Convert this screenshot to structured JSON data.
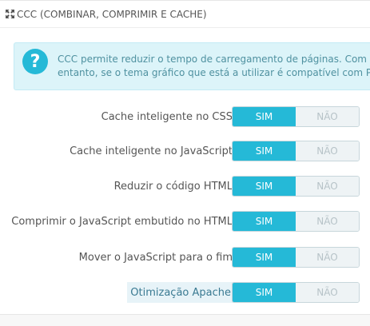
{
  "panel": {
    "title": "CCC (COMBINAR, COMPRIMIR E CACHE)",
    "title_icon": "expand-arrows-icon"
  },
  "alert": {
    "icon": "question-circle-icon",
    "line1": "CCC permite reduzir o tempo de carregamento de páginas. Com estas",
    "line2": "entanto, se o tema gráfico que está a utilizar é compatível com PrestaS",
    "colors": {
      "background": "#dcf4f9",
      "icon": "#25b9d7",
      "text": "#4f91a0"
    }
  },
  "options": [
    {
      "label": "Cache inteligente no CSS",
      "yes": "SIM",
      "no": "NÃO",
      "value": "yes"
    },
    {
      "label": "Cache inteligente no JavaScript",
      "yes": "SIM",
      "no": "NÃO",
      "value": "yes"
    },
    {
      "label": "Reduzir o código HTML",
      "yes": "SIM",
      "no": "NÃO",
      "value": "yes"
    },
    {
      "label": "Comprimir o JavaScript embutido no HTML",
      "yes": "SIM",
      "no": "NÃO",
      "value": "yes"
    },
    {
      "label": "Mover o JavaScript para o fim",
      "yes": "SIM",
      "no": "NÃO",
      "value": "yes"
    },
    {
      "label": "Otimização Apache",
      "yes": "SIM",
      "no": "NÃO",
      "value": "yes"
    }
  ],
  "colors": {
    "accent": "#25b9d7",
    "switch_off_bg": "#eef3f5",
    "switch_off_text": "#b7c3c8"
  }
}
